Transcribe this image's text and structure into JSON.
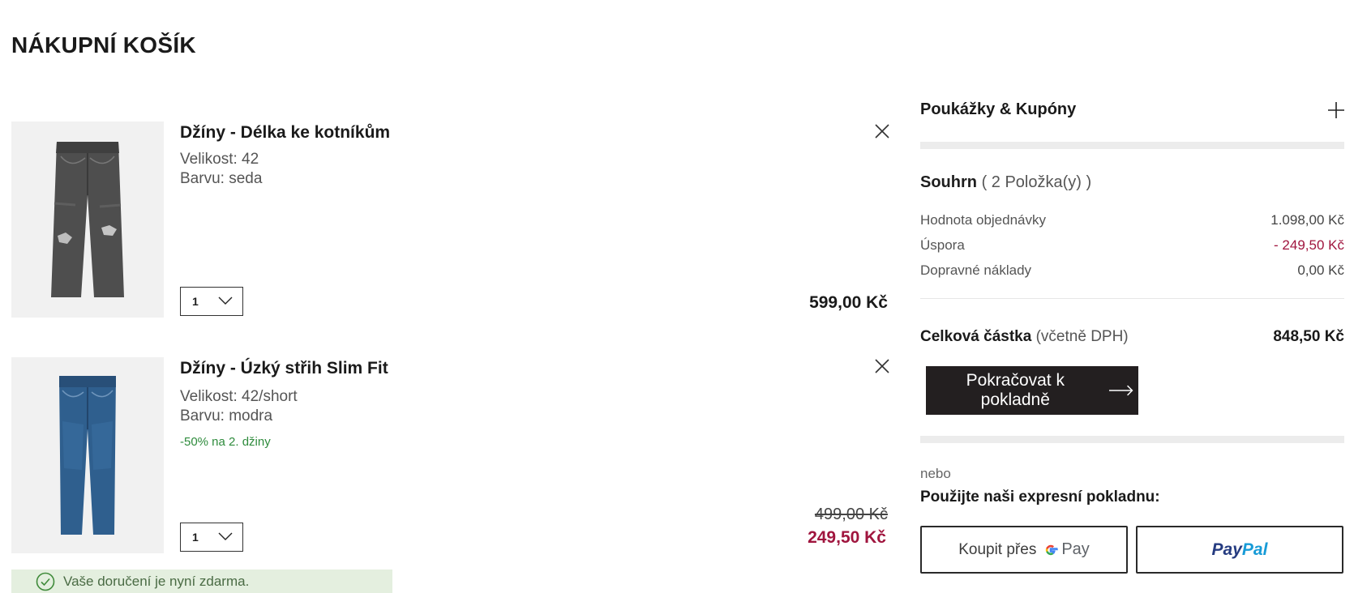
{
  "page_title": "NÁKUPNÍ KOŠÍK",
  "items": [
    {
      "name": "Džíny - Délka ke kotníkům",
      "size": "Velikost: 42",
      "color": "Barvu: seda",
      "qty": "1",
      "price": "599,00 Kč",
      "image_icon": "grey-jeans-image"
    },
    {
      "name": "Džíny - Úzký střih Slim Fit",
      "size": "Velikost: 42/short",
      "color": "Barvu: modra",
      "promo": "-50% na 2. džiny",
      "qty": "1",
      "old_price": "499,00 Kč",
      "sale_price": "249,50 Kč",
      "image_icon": "blue-jeans-image"
    }
  ],
  "delivery_notice": "Vaše doručení je nyní zdarma.",
  "coupons": {
    "label": "Poukážky & Kupóny",
    "icon": "plus-icon"
  },
  "summary": {
    "title": "Souhrn",
    "count": "( 2 Položka(y) )",
    "rows": [
      {
        "label": "Hodnota objednávky",
        "value": "1.098,00 Kč"
      },
      {
        "label": "Úspora",
        "value": "- 249,50 Kč"
      },
      {
        "label": "Dopravné náklady",
        "value": "0,00 Kč"
      }
    ],
    "total_label": "Celková částka",
    "total_note": "(včetně DPH)",
    "total_value": "848,50 Kč"
  },
  "checkout_label": "Pokračovat k pokladně",
  "or_label": "nebo",
  "express_label": "Použijte naši expresní pokladnu:",
  "gpay": {
    "prefix": "Koupit přes",
    "pay": "Pay"
  },
  "paypal": {
    "pay": "Pay",
    "pal": "Pal"
  },
  "colors": {
    "sale": "#a0153e",
    "promo": "#2e8b3c",
    "checkout_bg": "#231f20",
    "paypal_dark": "#253b80",
    "paypal_light": "#179bd7"
  }
}
